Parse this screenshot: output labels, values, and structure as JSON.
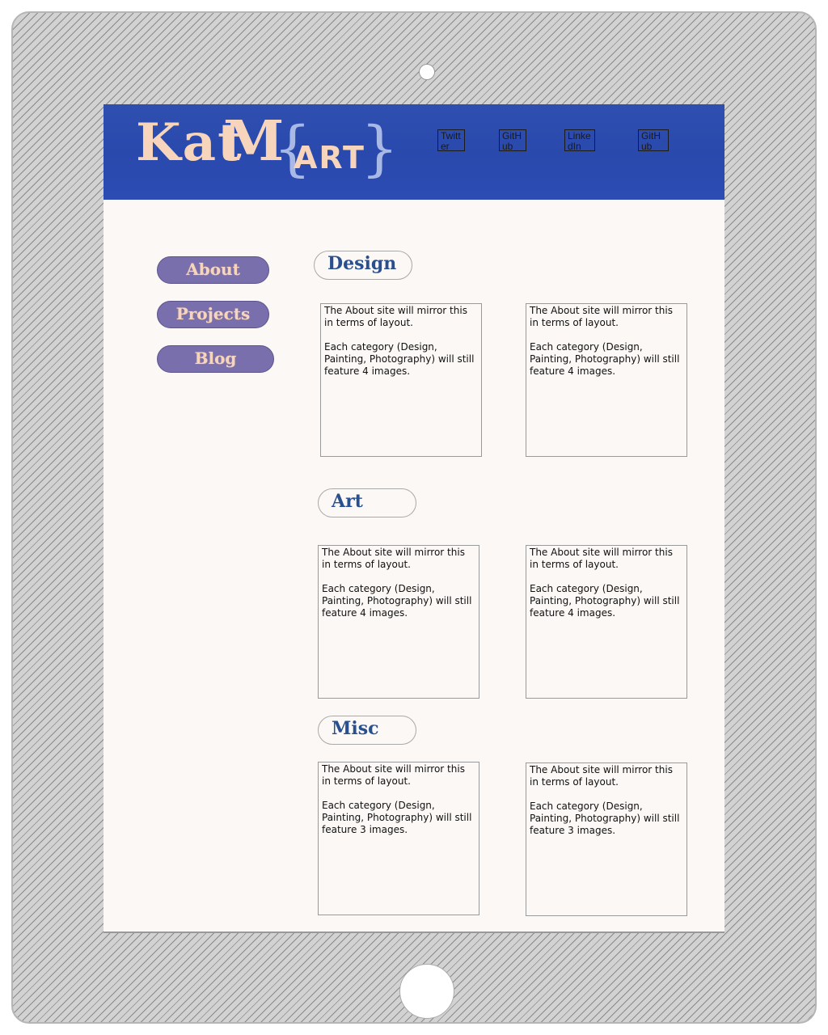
{
  "header": {
    "logo": {
      "kat": "Kat",
      "m": "M",
      "art": "ART",
      "lbrace": "{",
      "rbrace": "}"
    },
    "social": [
      "Twitter",
      "GitHub",
      "LinkedIn",
      "GitHub"
    ]
  },
  "nav": {
    "about": "About",
    "projects": "Projects",
    "blog": "Blog"
  },
  "sections": {
    "design": {
      "title": "Design",
      "cards": [
        {
          "line1": "The About site will mirror this in terms of layout.",
          "line2": "Each category (Design, Painting, Photography) will still feature 4 images."
        },
        {
          "line1": "The About site will mirror this in terms of layout.",
          "line2": "Each category (Design, Painting, Photography) will still feature 4 images."
        }
      ]
    },
    "art": {
      "title": "Art",
      "cards": [
        {
          "line1": "The About site will mirror this in terms of layout.",
          "line2": "Each category (Design, Painting, Photography) will still feature 4 images."
        },
        {
          "line1": "The About site will mirror this in terms of layout.",
          "line2": "Each category (Design, Painting, Photography) will still feature 4 images."
        }
      ]
    },
    "misc": {
      "title": "Misc",
      "cards": [
        {
          "line1": "The About site will mirror this in terms of layout.",
          "line2": "Each category (Design, Painting, Photography) will still feature 3 images."
        },
        {
          "line1": "The About site will mirror this in terms of layout.",
          "line2": "Each category (Design, Painting, Photography) will still feature 3 images."
        }
      ]
    }
  }
}
